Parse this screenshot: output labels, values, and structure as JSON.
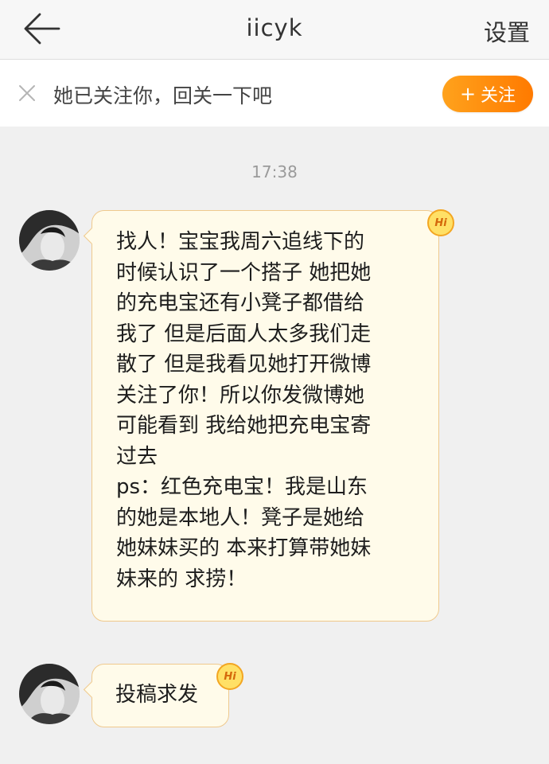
{
  "header": {
    "title": "iicyk",
    "settings_label": "设置"
  },
  "banner": {
    "text": "她已关注你，回关一下吧",
    "follow_label": "关注",
    "follow_icon": "+"
  },
  "chat": {
    "timestamp": "17:38",
    "messages": [
      {
        "text": "找人！宝宝我周六追线下的\n时候认识了一个搭子 她把她\n的充电宝还有小凳子都借给\n我了 但是后面人太多我们走\n散了 但是我看见她打开微博\n关注了你！所以你发微博她\n可能看到 我给她把充电宝寄\n过去\nps：红色充电宝！我是山东\n的她是本地人！凳子是她给\n她妹妹买的 本来打算带她妹\n妹来的 求捞！",
        "badge": "Hi"
      },
      {
        "text": "投稿求发",
        "badge": "Hi"
      }
    ]
  },
  "colors": {
    "accent": "#ff8a00",
    "bubble_bg": "#fffbea",
    "bubble_border": "#efc98d"
  },
  "icons": {
    "back": "back-arrow-icon",
    "close": "close-icon",
    "hi": "hi-badge-icon"
  }
}
